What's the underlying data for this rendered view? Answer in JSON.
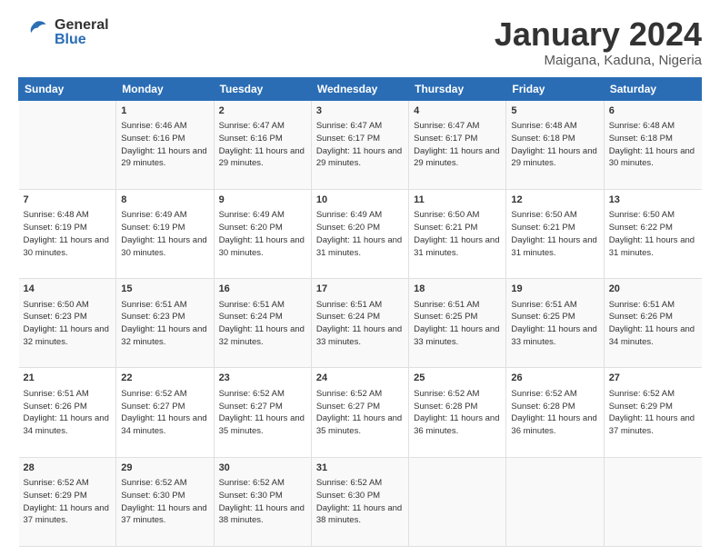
{
  "header": {
    "logo_general": "General",
    "logo_blue": "Blue",
    "month_title": "January 2024",
    "location": "Maigana, Kaduna, Nigeria"
  },
  "columns": [
    "Sunday",
    "Monday",
    "Tuesday",
    "Wednesday",
    "Thursday",
    "Friday",
    "Saturday"
  ],
  "weeks": [
    [
      {
        "day": "",
        "sunrise": "",
        "sunset": "",
        "daylight": ""
      },
      {
        "day": "1",
        "sunrise": "Sunrise: 6:46 AM",
        "sunset": "Sunset: 6:16 PM",
        "daylight": "Daylight: 11 hours and 29 minutes."
      },
      {
        "day": "2",
        "sunrise": "Sunrise: 6:47 AM",
        "sunset": "Sunset: 6:16 PM",
        "daylight": "Daylight: 11 hours and 29 minutes."
      },
      {
        "day": "3",
        "sunrise": "Sunrise: 6:47 AM",
        "sunset": "Sunset: 6:17 PM",
        "daylight": "Daylight: 11 hours and 29 minutes."
      },
      {
        "day": "4",
        "sunrise": "Sunrise: 6:47 AM",
        "sunset": "Sunset: 6:17 PM",
        "daylight": "Daylight: 11 hours and 29 minutes."
      },
      {
        "day": "5",
        "sunrise": "Sunrise: 6:48 AM",
        "sunset": "Sunset: 6:18 PM",
        "daylight": "Daylight: 11 hours and 29 minutes."
      },
      {
        "day": "6",
        "sunrise": "Sunrise: 6:48 AM",
        "sunset": "Sunset: 6:18 PM",
        "daylight": "Daylight: 11 hours and 30 minutes."
      }
    ],
    [
      {
        "day": "7",
        "sunrise": "Sunrise: 6:48 AM",
        "sunset": "Sunset: 6:19 PM",
        "daylight": "Daylight: 11 hours and 30 minutes."
      },
      {
        "day": "8",
        "sunrise": "Sunrise: 6:49 AM",
        "sunset": "Sunset: 6:19 PM",
        "daylight": "Daylight: 11 hours and 30 minutes."
      },
      {
        "day": "9",
        "sunrise": "Sunrise: 6:49 AM",
        "sunset": "Sunset: 6:20 PM",
        "daylight": "Daylight: 11 hours and 30 minutes."
      },
      {
        "day": "10",
        "sunrise": "Sunrise: 6:49 AM",
        "sunset": "Sunset: 6:20 PM",
        "daylight": "Daylight: 11 hours and 31 minutes."
      },
      {
        "day": "11",
        "sunrise": "Sunrise: 6:50 AM",
        "sunset": "Sunset: 6:21 PM",
        "daylight": "Daylight: 11 hours and 31 minutes."
      },
      {
        "day": "12",
        "sunrise": "Sunrise: 6:50 AM",
        "sunset": "Sunset: 6:21 PM",
        "daylight": "Daylight: 11 hours and 31 minutes."
      },
      {
        "day": "13",
        "sunrise": "Sunrise: 6:50 AM",
        "sunset": "Sunset: 6:22 PM",
        "daylight": "Daylight: 11 hours and 31 minutes."
      }
    ],
    [
      {
        "day": "14",
        "sunrise": "Sunrise: 6:50 AM",
        "sunset": "Sunset: 6:23 PM",
        "daylight": "Daylight: 11 hours and 32 minutes."
      },
      {
        "day": "15",
        "sunrise": "Sunrise: 6:51 AM",
        "sunset": "Sunset: 6:23 PM",
        "daylight": "Daylight: 11 hours and 32 minutes."
      },
      {
        "day": "16",
        "sunrise": "Sunrise: 6:51 AM",
        "sunset": "Sunset: 6:24 PM",
        "daylight": "Daylight: 11 hours and 32 minutes."
      },
      {
        "day": "17",
        "sunrise": "Sunrise: 6:51 AM",
        "sunset": "Sunset: 6:24 PM",
        "daylight": "Daylight: 11 hours and 33 minutes."
      },
      {
        "day": "18",
        "sunrise": "Sunrise: 6:51 AM",
        "sunset": "Sunset: 6:25 PM",
        "daylight": "Daylight: 11 hours and 33 minutes."
      },
      {
        "day": "19",
        "sunrise": "Sunrise: 6:51 AM",
        "sunset": "Sunset: 6:25 PM",
        "daylight": "Daylight: 11 hours and 33 minutes."
      },
      {
        "day": "20",
        "sunrise": "Sunrise: 6:51 AM",
        "sunset": "Sunset: 6:26 PM",
        "daylight": "Daylight: 11 hours and 34 minutes."
      }
    ],
    [
      {
        "day": "21",
        "sunrise": "Sunrise: 6:51 AM",
        "sunset": "Sunset: 6:26 PM",
        "daylight": "Daylight: 11 hours and 34 minutes."
      },
      {
        "day": "22",
        "sunrise": "Sunrise: 6:52 AM",
        "sunset": "Sunset: 6:27 PM",
        "daylight": "Daylight: 11 hours and 34 minutes."
      },
      {
        "day": "23",
        "sunrise": "Sunrise: 6:52 AM",
        "sunset": "Sunset: 6:27 PM",
        "daylight": "Daylight: 11 hours and 35 minutes."
      },
      {
        "day": "24",
        "sunrise": "Sunrise: 6:52 AM",
        "sunset": "Sunset: 6:27 PM",
        "daylight": "Daylight: 11 hours and 35 minutes."
      },
      {
        "day": "25",
        "sunrise": "Sunrise: 6:52 AM",
        "sunset": "Sunset: 6:28 PM",
        "daylight": "Daylight: 11 hours and 36 minutes."
      },
      {
        "day": "26",
        "sunrise": "Sunrise: 6:52 AM",
        "sunset": "Sunset: 6:28 PM",
        "daylight": "Daylight: 11 hours and 36 minutes."
      },
      {
        "day": "27",
        "sunrise": "Sunrise: 6:52 AM",
        "sunset": "Sunset: 6:29 PM",
        "daylight": "Daylight: 11 hours and 37 minutes."
      }
    ],
    [
      {
        "day": "28",
        "sunrise": "Sunrise: 6:52 AM",
        "sunset": "Sunset: 6:29 PM",
        "daylight": "Daylight: 11 hours and 37 minutes."
      },
      {
        "day": "29",
        "sunrise": "Sunrise: 6:52 AM",
        "sunset": "Sunset: 6:30 PM",
        "daylight": "Daylight: 11 hours and 37 minutes."
      },
      {
        "day": "30",
        "sunrise": "Sunrise: 6:52 AM",
        "sunset": "Sunset: 6:30 PM",
        "daylight": "Daylight: 11 hours and 38 minutes."
      },
      {
        "day": "31",
        "sunrise": "Sunrise: 6:52 AM",
        "sunset": "Sunset: 6:30 PM",
        "daylight": "Daylight: 11 hours and 38 minutes."
      },
      {
        "day": "",
        "sunrise": "",
        "sunset": "",
        "daylight": ""
      },
      {
        "day": "",
        "sunrise": "",
        "sunset": "",
        "daylight": ""
      },
      {
        "day": "",
        "sunrise": "",
        "sunset": "",
        "daylight": ""
      }
    ]
  ]
}
